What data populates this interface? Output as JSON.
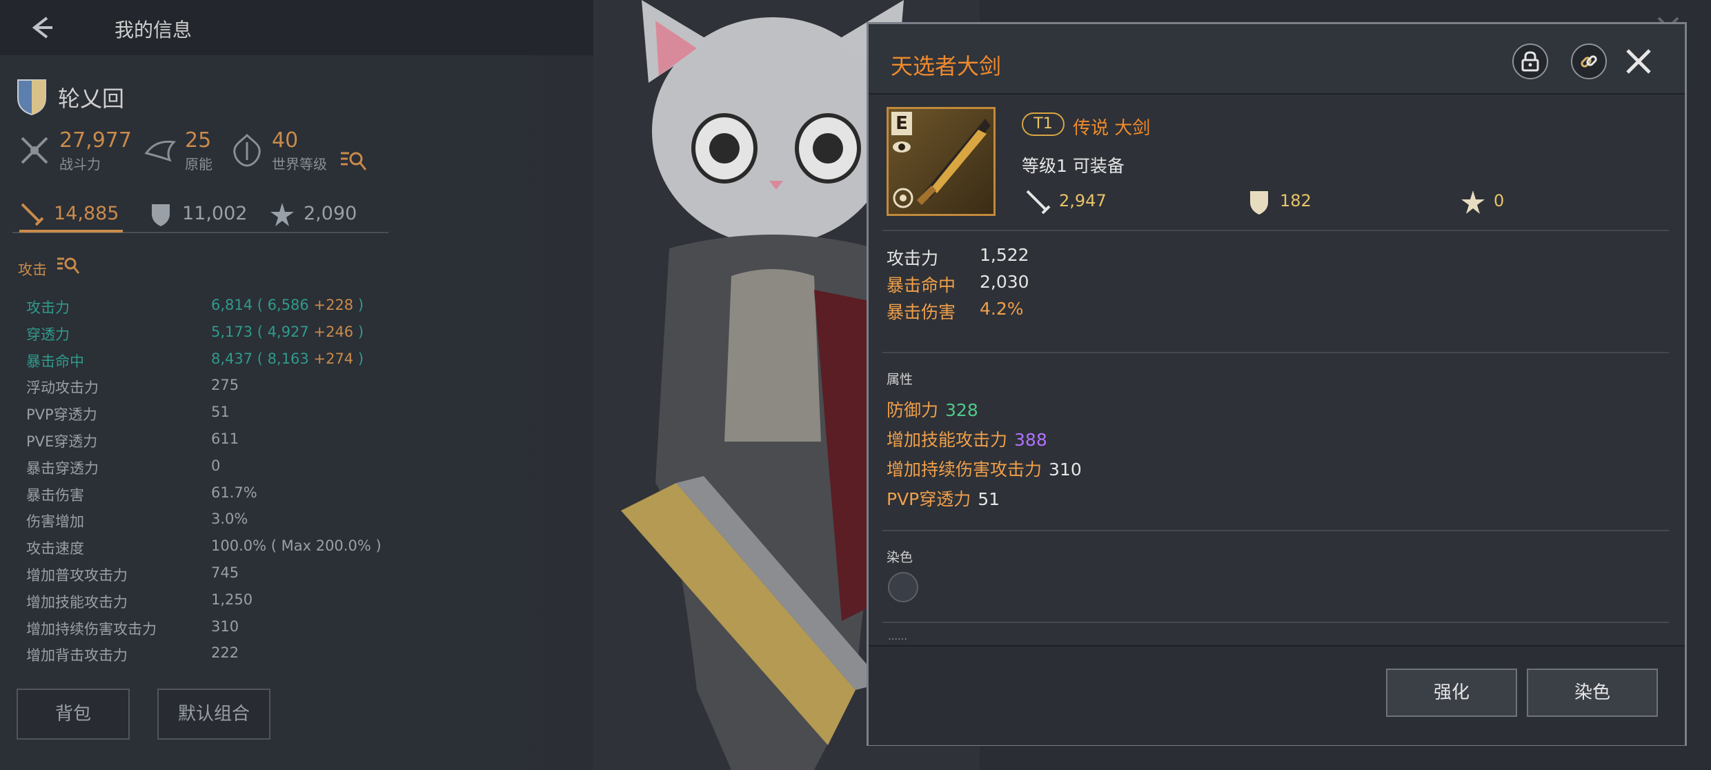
{
  "header": {
    "title": "我的信息"
  },
  "character": {
    "name": "轮乂回"
  },
  "summary": [
    {
      "value": "27,977",
      "label": "战斗力",
      "icon": "combat-power-icon"
    },
    {
      "value": "25",
      "label": "原能",
      "icon": "origin-energy-icon"
    },
    {
      "value": "40",
      "label": "世界等级",
      "icon": "world-level-icon"
    }
  ],
  "tabs": [
    {
      "value": "14,885",
      "icon": "sword-icon",
      "active": true
    },
    {
      "value": "11,002",
      "icon": "shield-icon",
      "active": false
    },
    {
      "value": "2,090",
      "icon": "star-burst-icon",
      "active": false
    }
  ],
  "section": {
    "label": "攻击"
  },
  "stats": [
    {
      "label": "攻击力",
      "value": "6,814 ( 6,586",
      "plus": "+",
      "bonus": "228",
      "close": " )",
      "highlight": true
    },
    {
      "label": "穿透力",
      "value": "5,173 ( 4,927",
      "plus": "+",
      "bonus": "246",
      "close": " )",
      "highlight": true
    },
    {
      "label": "暴击命中",
      "value": "8,437 ( 8,163",
      "plus": "+",
      "bonus": "274",
      "close": " )",
      "highlight": true
    },
    {
      "label": "浮动攻击力",
      "value": "275"
    },
    {
      "label": "PVP穿透力",
      "value": "51"
    },
    {
      "label": "PVE穿透力",
      "value": "611"
    },
    {
      "label": "暴击穿透力",
      "value": "0"
    },
    {
      "label": "暴击伤害",
      "value": "61.7%"
    },
    {
      "label": "伤害增加",
      "value": "3.0%"
    },
    {
      "label": "攻击速度",
      "value": "100.0% ( Max 200.0% )"
    },
    {
      "label": "增加普攻攻击力",
      "value": "745"
    },
    {
      "label": "增加技能攻击力",
      "value": "1,250"
    },
    {
      "label": "增加持续伤害攻击力",
      "value": "310"
    },
    {
      "label": "增加背击攻击力",
      "value": "222"
    }
  ],
  "bottom_buttons": {
    "bag": "背包",
    "combo": "默认组合"
  },
  "item": {
    "name": "天选者大剑",
    "icon_letter": "E",
    "tier": "T1",
    "rarity": "传说 大剑",
    "level_line": "等级1   可装备",
    "mini_stats": [
      {
        "value": "2,947",
        "icon": "sword-icon"
      },
      {
        "value": "182",
        "icon": "shield-icon"
      },
      {
        "value": "0",
        "icon": "star-burst-icon"
      }
    ],
    "main_stats": [
      {
        "label": "攻击力",
        "value": "1,522",
        "orange": false
      },
      {
        "label": "暴击命中",
        "value": "2,030",
        "orange": false
      },
      {
        "label": "暴击伤害",
        "value": "4.2%",
        "orange": true
      }
    ],
    "attr_label": "属性",
    "attributes": [
      {
        "label": "防御力",
        "value": "328",
        "color": "green"
      },
      {
        "label": "增加技能攻击力",
        "value": "388",
        "color": "purple"
      },
      {
        "label": "增加持续伤害攻击力",
        "value": "310",
        "color": "white"
      },
      {
        "label": "PVP穿透力",
        "value": "51",
        "color": "white"
      }
    ],
    "dye_label": "染色",
    "more_text": "……",
    "actions": {
      "enhance": "强化",
      "dye": "染色"
    }
  },
  "colors": {
    "accent_orange": "#f08a2c",
    "teal": "#2f9b8c",
    "green": "#4fc98a",
    "purple": "#b072ff",
    "gold": "#c18a3c"
  }
}
